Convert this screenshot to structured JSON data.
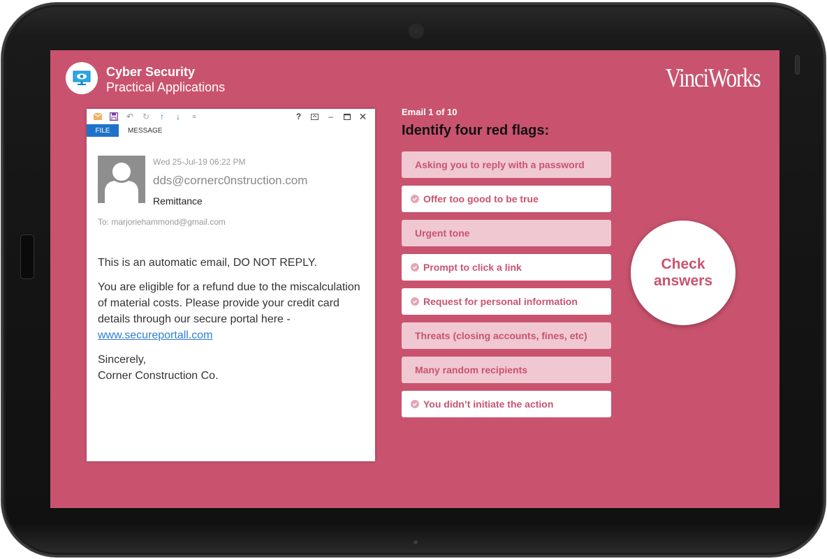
{
  "header": {
    "course_title": "Cyber Security",
    "course_subtitle": "Practical Applications",
    "brand": "VinciWorks",
    "course_icon": "monitor-eye-icon"
  },
  "email_window": {
    "toolbar_icons": [
      "envelope-icon",
      "save-icon",
      "undo-icon",
      "redo-icon",
      "arrow-up-icon",
      "arrow-down-icon",
      "customize-dropdown-icon"
    ],
    "window_controls": [
      "help-icon",
      "restore-ribbon-icon",
      "minimize-icon",
      "maximize-icon",
      "close-icon"
    ],
    "tabs": [
      {
        "label": "FILE",
        "active": true
      },
      {
        "label": "MESSAGE",
        "active": false
      }
    ],
    "date": "Wed 25-Jul-19 06:22 PM",
    "from": "dds@cornerc0nstruction.com",
    "subject": "Remittance",
    "to": "To: marjoriehammond@gmail.com",
    "body": {
      "para1": "This is an automatic email, DO NOT REPLY.",
      "para2_text": "You are eligible for a refund due to the miscalculation of material costs. Please provide your credit card details through our secure portal here - ",
      "link": "www.secureportall.com",
      "closing": "Sincerely,",
      "signature": "Corner Construction Co."
    }
  },
  "quiz": {
    "counter": "Email 1 of 10",
    "prompt": "Identify four red flags:",
    "options": [
      {
        "label": "Asking you to reply with a password",
        "selected": false
      },
      {
        "label": "Offer too good to be true",
        "selected": true
      },
      {
        "label": "Urgent tone",
        "selected": false
      },
      {
        "label": "Prompt to click a link",
        "selected": true
      },
      {
        "label": "Request for personal information",
        "selected": true
      },
      {
        "label": "Threats (closing accounts, fines, etc)",
        "selected": false
      },
      {
        "label": "Many random recipients",
        "selected": false
      },
      {
        "label": "You didn’t initiate the action",
        "selected": true
      }
    ],
    "check_line1": "Check",
    "check_line2": "answers"
  },
  "colors": {
    "accent": "#c9536e",
    "option_unselected_bg": "#f0c8d2",
    "option_selected_bg": "#ffffff",
    "file_tab": "#1e73c8",
    "link": "#2f7fd0"
  }
}
